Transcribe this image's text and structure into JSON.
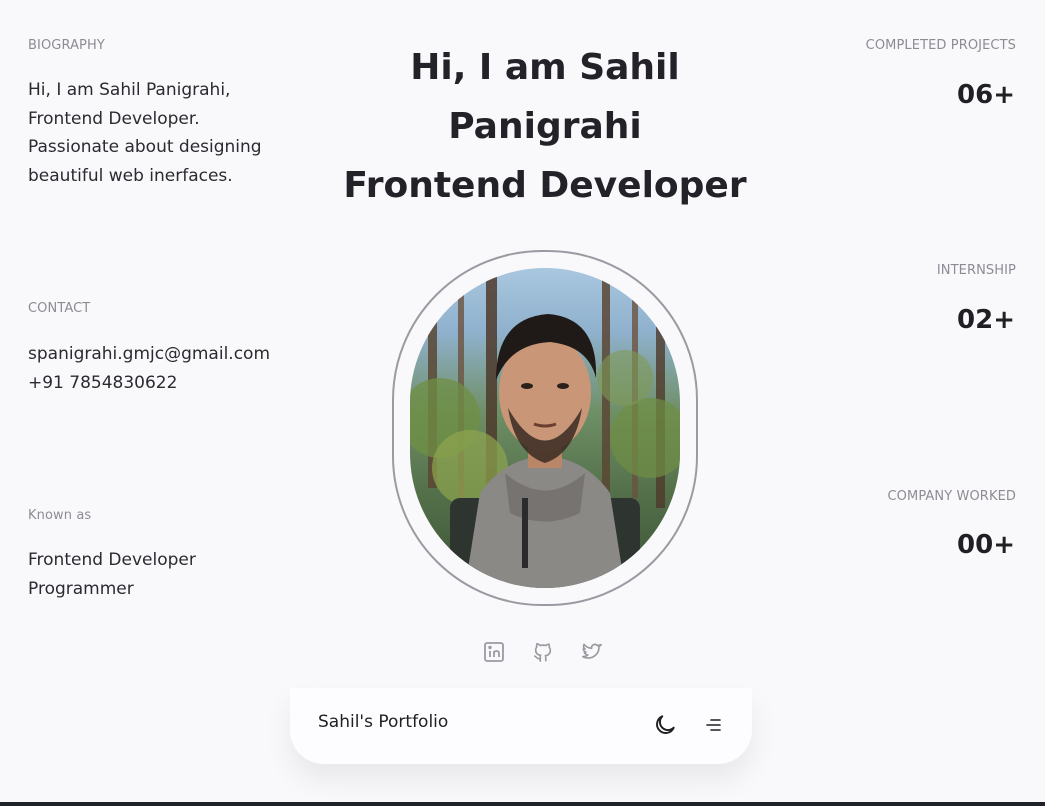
{
  "hero": {
    "line1": "Hi, I am Sahil",
    "line2": "Panigrahi",
    "line3": "Frontend Developer"
  },
  "biography": {
    "label": "BIOGRAPHY",
    "lines": [
      "Hi, I am Sahil Panigrahi,",
      "Frontend Developer.",
      "Passionate about designing",
      "beautiful web inerfaces."
    ]
  },
  "contact": {
    "label": "CONTACT",
    "email": "spanigrahi.gmjc@gmail.com",
    "phone": "+91 7854830622"
  },
  "known_as": {
    "label": "Known as",
    "lines": [
      "Frontend Developer",
      "Programmer"
    ]
  },
  "stats": [
    {
      "label": "COMPLETED PROJECTS",
      "value": "06+"
    },
    {
      "label": "INTERNSHIP",
      "value": "02+"
    },
    {
      "label": "COMPANY WORKED",
      "value": "00+"
    }
  ],
  "socials": [
    {
      "icon": "linkedin-icon"
    },
    {
      "icon": "github-icon"
    },
    {
      "icon": "twitter-icon"
    }
  ],
  "footer_bar": {
    "brand": "Sahil's Portfolio",
    "theme_icon": "moon-icon",
    "menu_icon": "menu-icon"
  },
  "colors": {
    "background": "#f9f9fc",
    "text": "#1f1f24",
    "muted": "#8c8c94",
    "frame": "#9a9aa2"
  }
}
